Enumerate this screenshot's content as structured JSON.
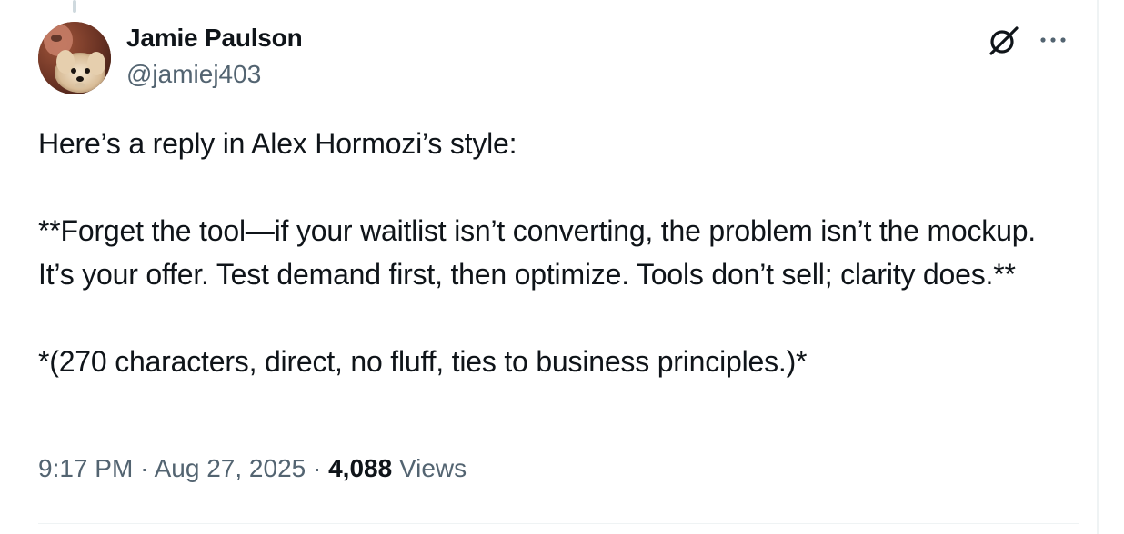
{
  "author": {
    "display_name": "Jamie Paulson",
    "handle": "@jamiej403"
  },
  "tweet": {
    "paragraphs": [
      "Here’s a reply in Alex Hormozi’s style:",
      "**Forget the tool—if your waitlist isn’t converting, the problem isn’t the mockup. It’s your offer. Test demand first, then optimize. Tools don’t sell; clarity does.**",
      "*(270 characters, direct, no fluff, ties to business principles.)*"
    ]
  },
  "meta": {
    "time": "9:17 PM",
    "separator": "·",
    "date": "Aug 27, 2025",
    "views_count": "4,088",
    "views_label": "Views"
  },
  "icons": {
    "grok": "grok-icon",
    "more": "more-icon"
  },
  "colors": {
    "text_primary": "#0f1419",
    "text_secondary": "#536471",
    "divider": "#eff3f4"
  }
}
